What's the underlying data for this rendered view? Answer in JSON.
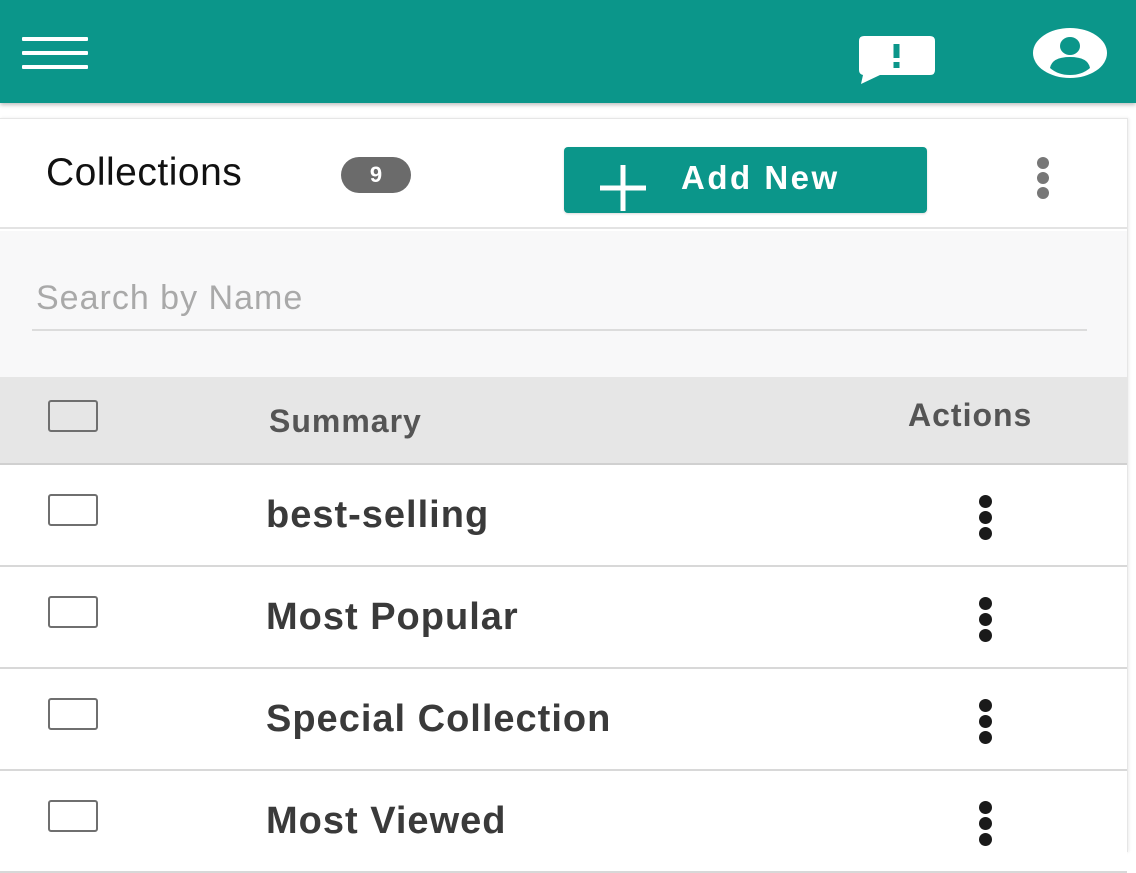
{
  "appbar": {
    "menu_icon": "hamburger-menu-icon",
    "feedback_icon": "feedback-icon",
    "account_icon": "account-circle-icon",
    "color": "#0b968a"
  },
  "collections": {
    "title": "Collections",
    "count": "9",
    "add_new_label": "Add New",
    "more_icon": "more-vertical-icon"
  },
  "search": {
    "placeholder": "Search by Name",
    "value": ""
  },
  "table": {
    "columns": {
      "summary": "Summary",
      "actions": "Actions"
    },
    "rows": [
      {
        "summary": "best-selling"
      },
      {
        "summary": "Most Popular"
      },
      {
        "summary": "Special Collection"
      },
      {
        "summary": "Most Viewed"
      }
    ]
  }
}
